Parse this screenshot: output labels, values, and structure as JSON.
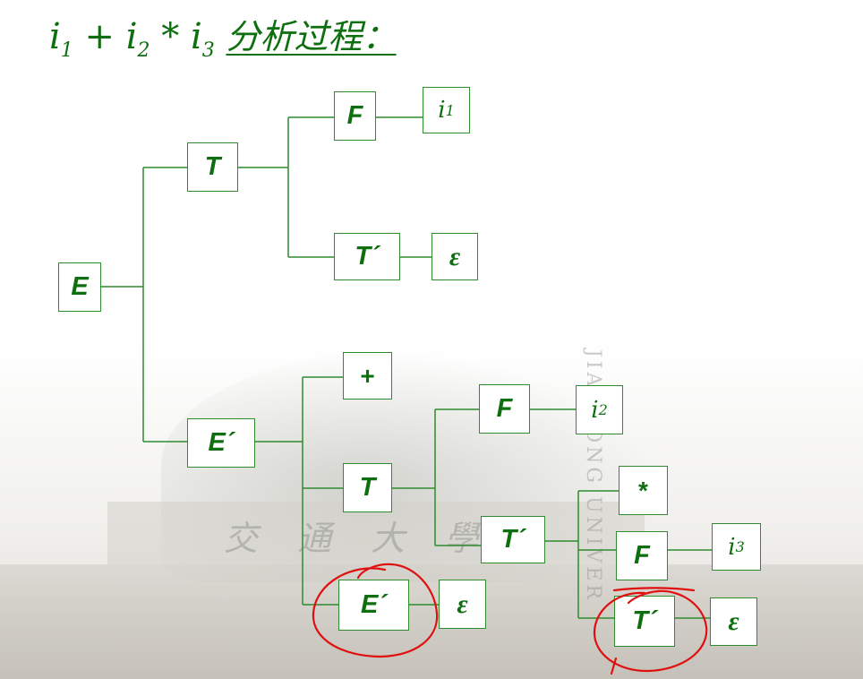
{
  "title": {
    "i1_base": "i",
    "i1_sub": "1",
    "plus": "+",
    "i2_base": "i",
    "i2_sub": "2",
    "star": "*",
    "i3_base": "i",
    "i3_sub": "3",
    "suffix": "分析过程："
  },
  "tree": {
    "E": "E",
    "T_top": "T",
    "F_top": "F",
    "i1": {
      "base": "i",
      "sub": "1"
    },
    "Tp_top": "T´",
    "eps_top": "ε",
    "Ep": "E´",
    "plus": "+",
    "T_mid": "T",
    "F_mid": "F",
    "i2": {
      "base": "i",
      "sub": "2"
    },
    "Tp_mid": "T´",
    "star": "*",
    "F_low": "F",
    "i3": {
      "base": "i",
      "sub": "3"
    },
    "Tp_low": "T´",
    "eps_low": "ε",
    "Ep_low": "E´",
    "eps_mid": "ε"
  },
  "background": {
    "building_sign": "交 通 大 學",
    "arc_text": "JIAOTONG UNIVER"
  },
  "colors": {
    "node_text": "#0e6f0e",
    "node_border": "#2e8b2e",
    "annotation": "#e01010"
  }
}
